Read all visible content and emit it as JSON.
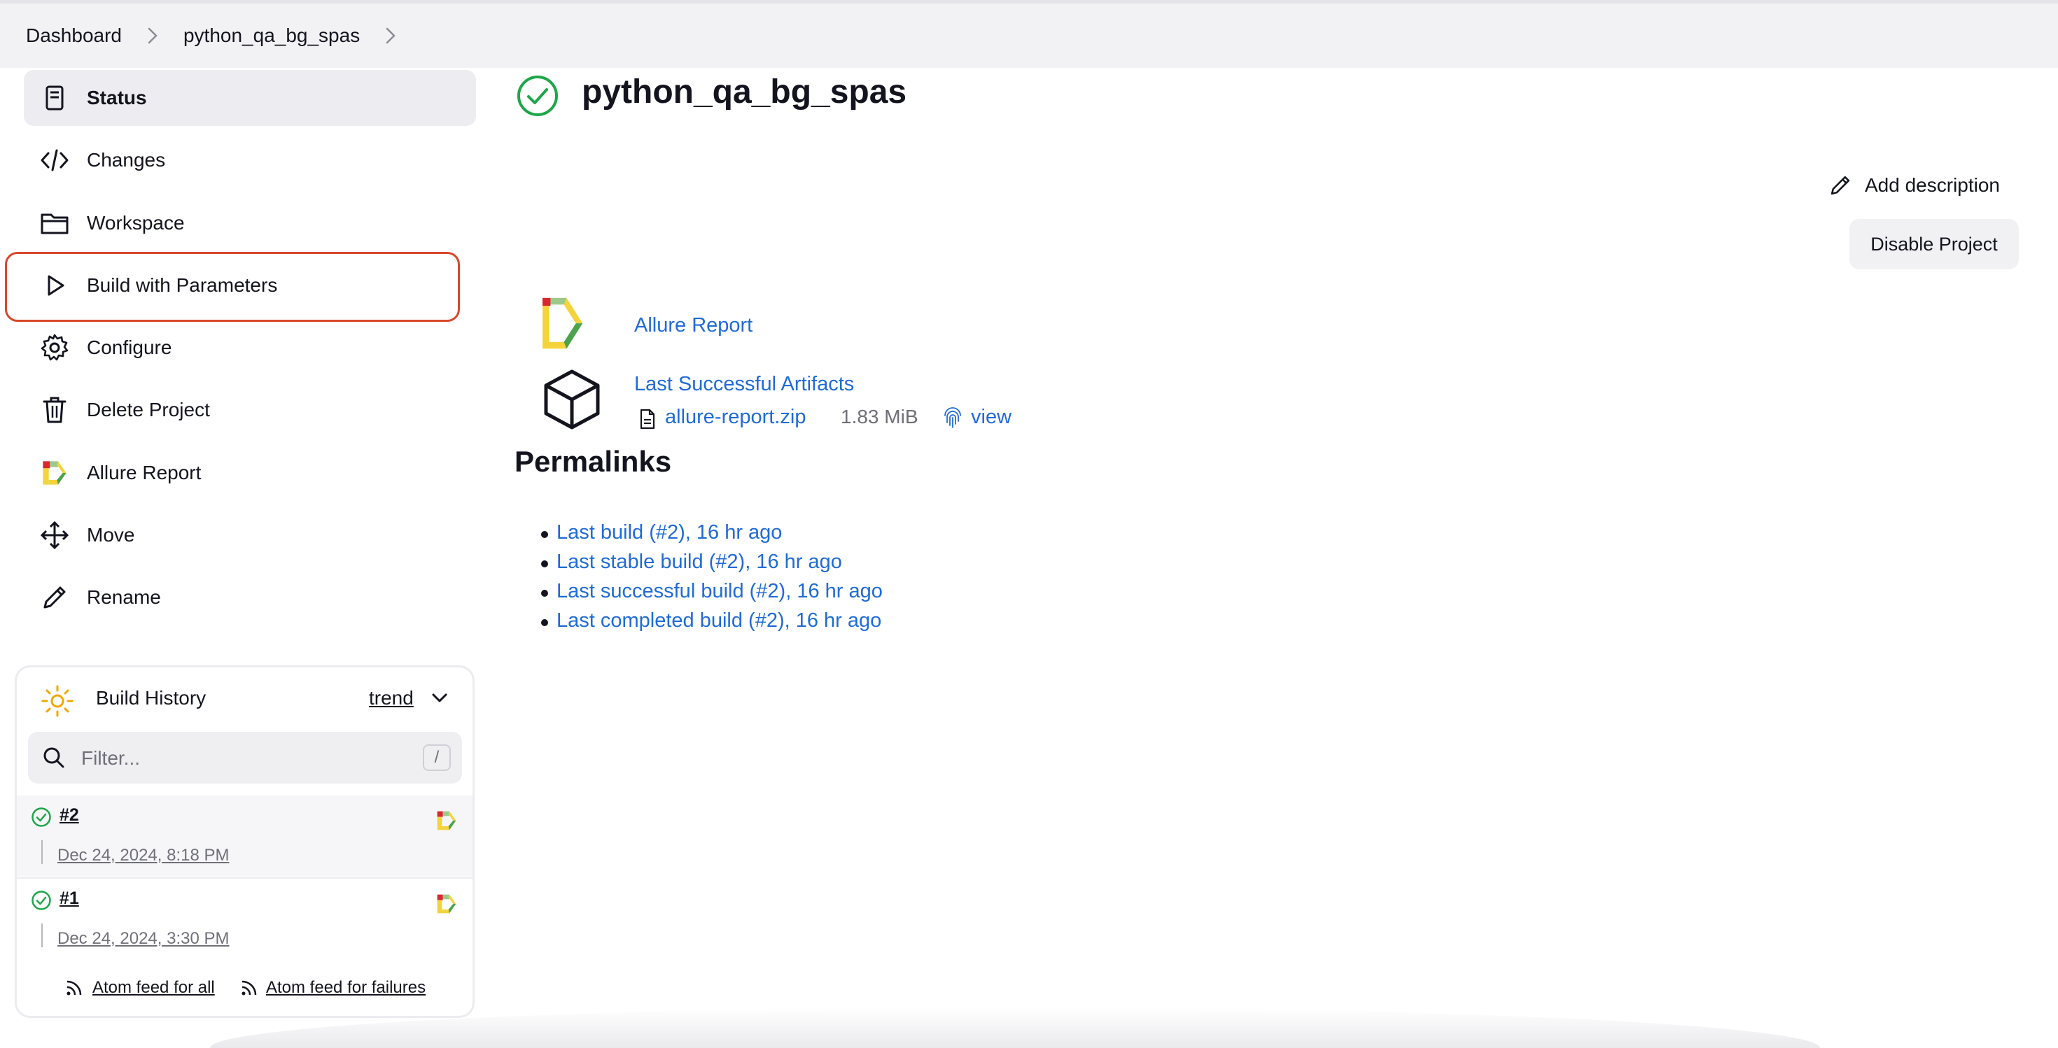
{
  "breadcrumb": {
    "items": [
      "Dashboard",
      "python_qa_bg_spas"
    ]
  },
  "sidebar": {
    "items": [
      {
        "label": "Status",
        "icon": "document-icon"
      },
      {
        "label": "Changes",
        "icon": "code-icon"
      },
      {
        "label": "Workspace",
        "icon": "folder-icon"
      },
      {
        "label": "Build with Parameters",
        "icon": "play-icon"
      },
      {
        "label": "Configure",
        "icon": "gear-icon"
      },
      {
        "label": "Delete Project",
        "icon": "trash-icon"
      },
      {
        "label": "Allure Report",
        "icon": "allure-logo-icon"
      },
      {
        "label": "Move",
        "icon": "move-arrows-icon"
      },
      {
        "label": "Rename",
        "icon": "pencil-icon"
      }
    ]
  },
  "build_history": {
    "title": "Build History",
    "trend_label": "trend",
    "filter_placeholder": "Filter...",
    "shortcut_key": "/",
    "builds": [
      {
        "number": "#2",
        "date": "Dec 24, 2024, 8:18 PM"
      },
      {
        "number": "#1",
        "date": "Dec 24, 2024, 3:30 PM"
      }
    ],
    "feed_all": "Atom feed for all",
    "feed_failures": "Atom feed for failures"
  },
  "main": {
    "title": "python_qa_bg_spas",
    "add_description": "Add description",
    "disable_project": "Disable Project",
    "allure_report_link": "Allure Report",
    "artifacts": {
      "title": "Last Successful Artifacts",
      "file_name": "allure-report.zip",
      "file_size": "1.83 MiB",
      "view_label": "view"
    },
    "permalinks_title": "Permalinks",
    "permalinks": [
      "Last build (#2), 16 hr ago",
      "Last stable build (#2), 16 hr ago",
      "Last successful build (#2), 16 hr ago",
      "Last completed build (#2), 16 hr ago"
    ]
  },
  "colors": {
    "link": "#1f6bd6",
    "success": "#1ea64a",
    "highlight": "#d9472b",
    "trend_sun": "#f0a800"
  }
}
